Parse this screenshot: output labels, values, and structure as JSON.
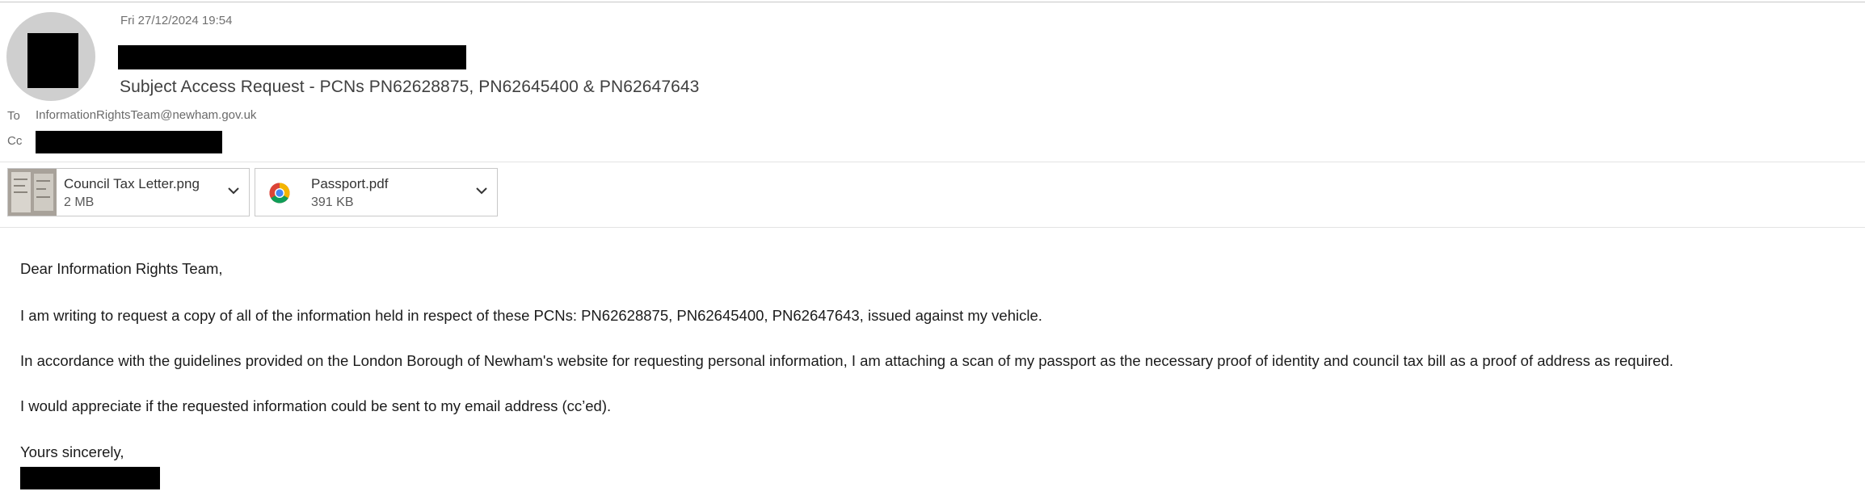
{
  "email": {
    "date": "Fri 27/12/2024 19:54",
    "subject": "Subject Access Request - PCNs PN62628875, PN62645400 & PN62647643",
    "to_label": "To",
    "to_address": "InformationRightsTeam@newham.gov.uk",
    "cc_label": "Cc"
  },
  "attachments": [
    {
      "name": "Council Tax Letter.png",
      "size": "2 MB",
      "icon": "image-thumbnail"
    },
    {
      "name": "Passport.pdf",
      "size": "391 KB",
      "icon": "chrome-icon"
    }
  ],
  "body": {
    "greeting": "Dear Information Rights Team,",
    "para1": "I am writing to request a copy of all of the information held in respect of these PCNs: PN62628875, PN62645400, PN62647643, issued against my vehicle.",
    "para2": "In accordance with the guidelines provided on the London Borough of Newham's website for requesting personal information, I am attaching a scan of my passport as the necessary proof of identity and council tax bill as a proof of address as required.",
    "para3": "I would appreciate if the requested information could be sent to my email address (cc’ed).",
    "closing": "Yours sincerely,"
  }
}
